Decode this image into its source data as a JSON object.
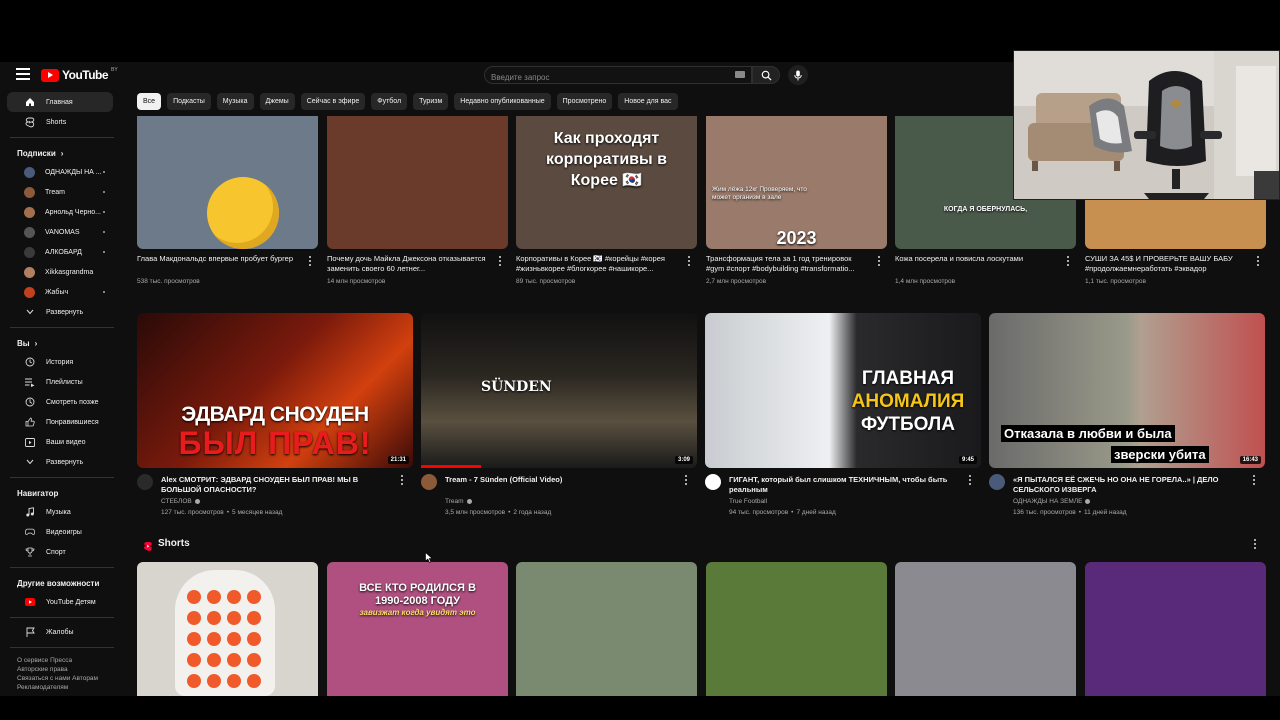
{
  "header": {
    "logo_text": "YouTube",
    "country_code": "BY",
    "search_placeholder": "Введите запрос"
  },
  "sidebar": {
    "main": [
      {
        "label": "Главная",
        "icon": "home-icon",
        "active": true
      },
      {
        "label": "Shorts",
        "icon": "shorts-icon"
      }
    ],
    "subscriptions_header": "Подписки",
    "subscriptions": [
      {
        "label": "ОДНАЖДЫ НА ...",
        "avatar_color": "#4a5a7a",
        "dot": true
      },
      {
        "label": "Tream",
        "avatar_color": "#8a5a3a",
        "dot": true
      },
      {
        "label": "Арнольд Черно...",
        "avatar_color": "#a07050",
        "dot": true
      },
      {
        "label": "VANOMAS",
        "avatar_color": "#555555",
        "dot": true
      },
      {
        "label": "АЛКОБАРД",
        "avatar_color": "#3a3a3a",
        "dot": true
      },
      {
        "label": "Xikkasgrandma",
        "avatar_color": "#b08060",
        "dot": false
      },
      {
        "label": "Жабыч",
        "avatar_color": "#c04020",
        "dot": true
      }
    ],
    "expand_label": "Развернуть",
    "you_header": "Вы",
    "you_items": [
      {
        "label": "История",
        "icon": "history-icon"
      },
      {
        "label": "Плейлисты",
        "icon": "playlists-icon"
      },
      {
        "label": "Смотреть позже",
        "icon": "watch-later-icon"
      },
      {
        "label": "Понравившиеся",
        "icon": "liked-icon"
      },
      {
        "label": "Ваши видео",
        "icon": "your-videos-icon"
      },
      {
        "label": "Развернуть",
        "icon": "chevron-down-icon"
      }
    ],
    "navigator_header": "Навигатор",
    "navigator_items": [
      {
        "label": "Музыка",
        "icon": "music-icon"
      },
      {
        "label": "Видеоигры",
        "icon": "gaming-icon"
      },
      {
        "label": "Спорт",
        "icon": "trophy-icon"
      }
    ],
    "more_header": "Другие возможности",
    "more_items": [
      {
        "label": "YouTube Детям",
        "icon": "youtube-kids-icon"
      }
    ],
    "report_label": "Жалобы",
    "footer": "О сервисе  Пресса  Авторские права  Связаться с нами  Авторам  Рекламодателям"
  },
  "chips": [
    "Все",
    "Подкасты",
    "Музыка",
    "Джемы",
    "Сейчас в эфире",
    "Футбол",
    "Туризм",
    "Недавно опубликованные",
    "Просмотрено",
    "Новое для вас"
  ],
  "row1": [
    {
      "title": "Глава Макдональдс впервые пробует бургер",
      "views": "538 тыс. просмотров",
      "bg": "#6d7a8a"
    },
    {
      "title": "Почему дочь Майкла Джексона отказывается заменить своего 60 летнег...",
      "views": "14 млн просмотров",
      "bg": "#6a3b2a"
    },
    {
      "title": "Корпоративы в Корее 🇰🇷 #корейцы #корея #жизньвкорее #блогкорее #нашикоре...",
      "views": "89 тыс. просмотров",
      "bg": "#5a4a40",
      "caption": "Как проходят корпоративы в Корее 🇰🇷"
    },
    {
      "title": "Трансформация тела за 1 год тренировок #gym #спорт #bodybuilding #transformatio...",
      "views": "2,7 млн просмотров",
      "bg": "#9a7a6a",
      "caption": "2023",
      "small_caption": "Жим лёжа 12кг Проверяем, что может организм в зале"
    },
    {
      "title": "Кожа посерела и повисла лоскутами",
      "views": "1,4 млн просмотров",
      "bg": "#4a5a4a",
      "caption": "КОГДА Я ОБЕРНУЛАСЬ,"
    },
    {
      "title": "СУШИ ЗА 45$ И ПРОВЕРЬТЕ ВАШУ БАБУ #продолжаемнеработать #эквадор",
      "views": "1,1 тыс. просмотров",
      "bg": "#c89050"
    }
  ],
  "row2": [
    {
      "title": "Alex СМОТРИТ: ЭДВАРД СНОУДЕН БЫЛ ПРАВ! МЫ В БОЛЬШОЙ ОПАСНОСТИ?",
      "channel": "СТЕБЛОВ",
      "verified": true,
      "views": "127 тыс. просмотров",
      "age": "5 месяцев назад",
      "duration": "21:31",
      "caption1": "ЭДВАРД СНОУДЕН",
      "caption2": "БЫЛ ПРАВ!",
      "avatar_color": "#2a2a2a"
    },
    {
      "title": "Tream - 7 Sünden (Official Video)",
      "channel": "Tream",
      "verified": true,
      "views": "3,5 млн просмотров",
      "age": "2 года назад",
      "duration": "3:09",
      "caption1": "SÜNDEN",
      "avatar_color": "#8a5a3a"
    },
    {
      "title": "ГИГАНТ, который был слишком ТЕХНИЧНЫМ, чтобы быть реальным",
      "channel": "True Football",
      "verified": false,
      "views": "94 тыс. просмотров",
      "age": "7 дней назад",
      "duration": "9:45",
      "caption1": "ГЛАВНАЯ",
      "caption2": "АНОМАЛИЯ",
      "caption3": "ФУТБОЛА",
      "avatar_color": "#ffffff"
    },
    {
      "title": "«Я ПЫТАЛСЯ ЕЁ СЖЕЧЬ НО ОНА НЕ ГОРЕЛА..» | ДЕЛО СЕЛЬСКОГО ИЗВЕРГА",
      "channel": "ОДНАЖДЫ НА ЗЕМЛЕ",
      "verified": true,
      "views": "136 тыс. просмотров",
      "age": "11 дней назад",
      "duration": "16:43",
      "caption1": "Отказала в любви и была",
      "caption2": "зверски убита",
      "avatar_color": "#4a5a7a"
    }
  ],
  "shorts": {
    "header": "Shorts",
    "items": [
      {
        "bg": "#d8d4ce"
      },
      {
        "bg": "#b05080",
        "caption": "ВСЕ КТО РОДИЛСЯ В 1990-2008 ГОДУ",
        "sub": "завизжат когда увидят это"
      },
      {
        "bg": "#7a8a70"
      },
      {
        "bg": "#5a7a3a"
      },
      {
        "bg": "#8a8a90"
      },
      {
        "bg": "#5a2a7a"
      }
    ]
  }
}
